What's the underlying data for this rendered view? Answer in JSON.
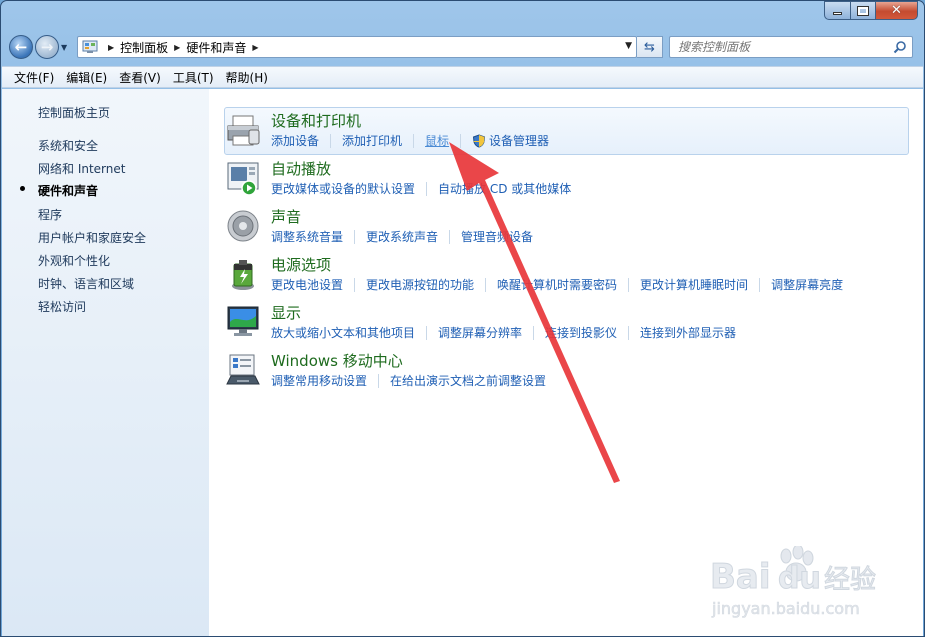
{
  "address": {
    "crumbs": [
      "控制面板",
      "硬件和声音"
    ],
    "search_placeholder": "搜索控制面板"
  },
  "menu": [
    "文件(F)",
    "编辑(E)",
    "查看(V)",
    "工具(T)",
    "帮助(H)"
  ],
  "sidebar": {
    "items": [
      {
        "label": "控制面板主页"
      },
      {
        "label": "系统和安全"
      },
      {
        "label": "网络和 Internet"
      },
      {
        "label": "硬件和声音",
        "current": true
      },
      {
        "label": "程序"
      },
      {
        "label": "用户帐户和家庭安全"
      },
      {
        "label": "外观和个性化"
      },
      {
        "label": "时钟、语言和区域"
      },
      {
        "label": "轻松访问"
      }
    ]
  },
  "categories": [
    {
      "title": "设备和打印机",
      "icon": "printer-icon",
      "links": [
        "添加设备",
        "添加打印机",
        "鼠标",
        "设备管理器"
      ]
    },
    {
      "title": "自动播放",
      "icon": "autoplay-icon",
      "links": [
        "更改媒体或设备的默认设置",
        "自动播放 CD 或其他媒体"
      ]
    },
    {
      "title": "声音",
      "icon": "speaker-icon",
      "links": [
        "调整系统音量",
        "更改系统声音",
        "管理音频设备"
      ]
    },
    {
      "title": "电源选项",
      "icon": "battery-icon",
      "links": [
        "更改电池设置",
        "更改电源按钮的功能",
        "唤醒计算机时需要密码",
        "更改计算机睡眠时间",
        "调整屏幕亮度"
      ]
    },
    {
      "title": "显示",
      "icon": "monitor-icon",
      "links": [
        "放大或缩小文本和其他项目",
        "调整屏幕分辨率",
        "连接到投影仪",
        "连接到外部显示器"
      ]
    },
    {
      "title": "Windows 移动中心",
      "icon": "mobility-center-icon",
      "links": [
        "调整常用移动设置",
        "在给出演示文档之前调整设置"
      ]
    }
  ],
  "watermark": {
    "logo": "Baidu经验",
    "url": "jingyan.baidu.com"
  },
  "colors": {
    "link": "#1f5fb4",
    "category_title": "#1e6b1e",
    "annotation_arrow": "#e8363a"
  }
}
